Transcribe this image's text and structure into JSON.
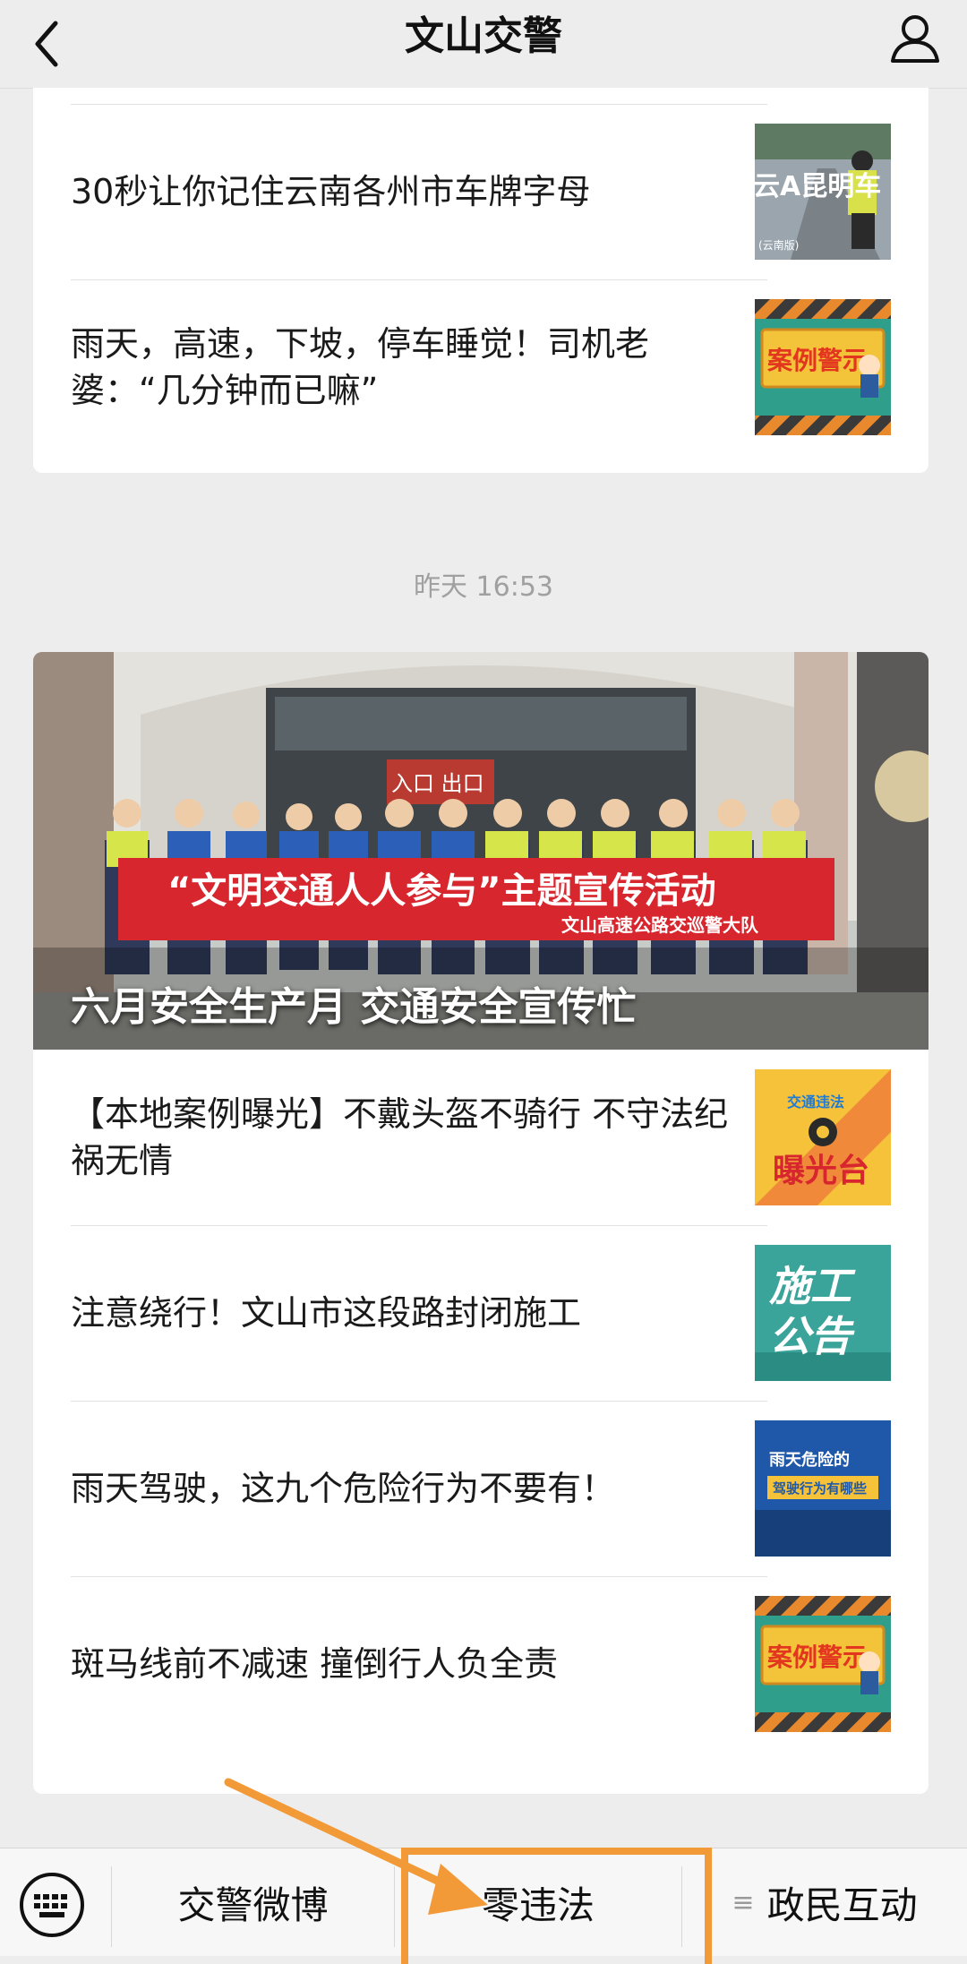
{
  "header": {
    "title": "文山交警",
    "back_icon": "chevron-left-icon",
    "profile_icon": "user-icon"
  },
  "top_card": {
    "articles": [
      {
        "title": "30秒让你记住云南各州市车牌字母",
        "thumb_text": "云A昆明车",
        "thumb_subtext": "(云南版)"
      },
      {
        "title": "雨天，高速，下坡，停车睡觉！司机老婆：“几分钟而已嘛”",
        "thumb_text": "案例警示"
      }
    ]
  },
  "timestamp": "昨天 16:53",
  "bottom_card": {
    "hero": {
      "caption": "六月安全生产月 交通安全宣传忙",
      "banner_main": "“文明交通人人参与”主题宣传活动",
      "banner_sub": "文山高速公路交巡警大队",
      "sign_text": "入口  出口"
    },
    "articles": [
      {
        "title": "【本地案例曝光】不戴头盔不骑行 不守法纪祸无情",
        "thumb_top": "交通违法",
        "thumb_main": "曝光台"
      },
      {
        "title": "注意绕行！文山市这段路封闭施工",
        "thumb_line1": "施工",
        "thumb_line2": "公告"
      },
      {
        "title": "雨天驾驶，这九个危险行为不要有！",
        "thumb_line1": "雨天危险的",
        "thumb_line2": "驾驶行为有哪些"
      },
      {
        "title": "斑马线前不减速 撞倒行人负全责",
        "thumb_text": "案例警示"
      }
    ]
  },
  "bottom_menu": {
    "keyboard_icon": "keyboard-icon",
    "items": [
      {
        "label": "交警微博"
      },
      {
        "label": "零违法"
      },
      {
        "label": "政民互动",
        "prefix": "≡"
      }
    ]
  },
  "colors": {
    "annotation": "#f29a37",
    "background": "#ededed",
    "card": "#ffffff"
  }
}
